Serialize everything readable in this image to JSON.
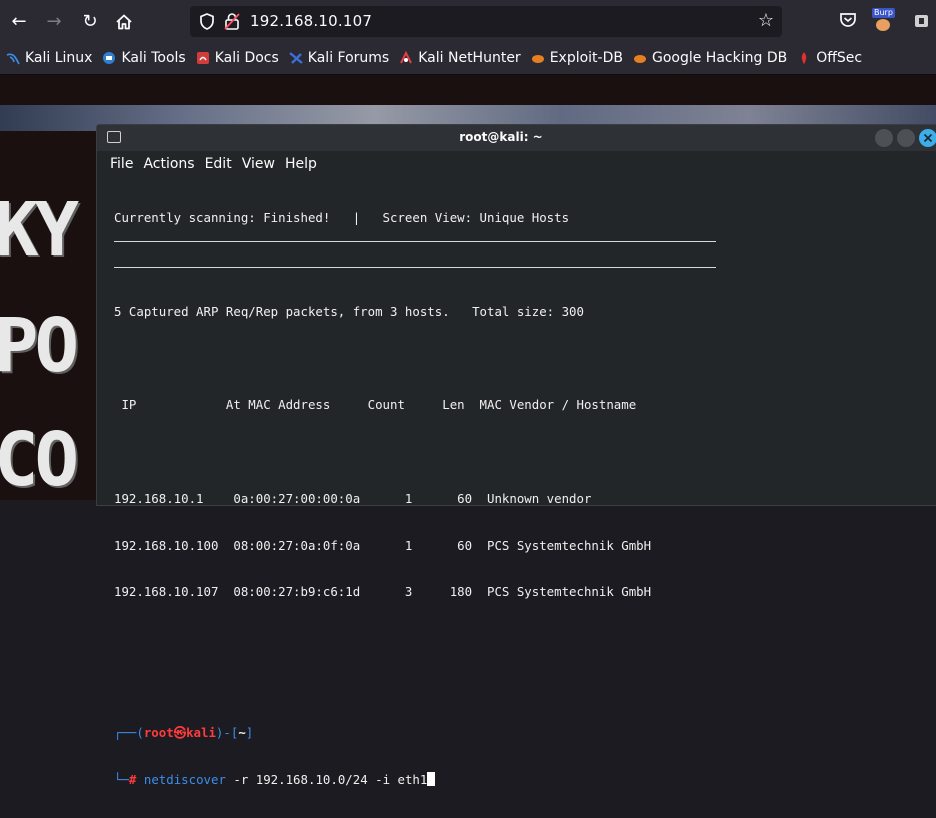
{
  "browser": {
    "url": "192.168.10.107",
    "burp_badge": "Burp"
  },
  "bookmarks": [
    {
      "label": "Kali Linux",
      "icon": "kali-dragon-icon",
      "color": "#3b8eea"
    },
    {
      "label": "Kali Tools",
      "icon": "kali-tools-icon",
      "color": "#2d7fd3"
    },
    {
      "label": "Kali Docs",
      "icon": "kali-docs-icon",
      "color": "#d23c3c"
    },
    {
      "label": "Kali Forums",
      "icon": "kali-forums-icon",
      "color": "#3a6fd8"
    },
    {
      "label": "Kali NetHunter",
      "icon": "nethunter-icon",
      "color": "#e04040"
    },
    {
      "label": "Exploit-DB",
      "icon": "exploit-db-icon",
      "color": "#e67e22"
    },
    {
      "label": "Google Hacking DB",
      "icon": "ghdb-icon",
      "color": "#e67e22"
    },
    {
      "label": "OffSec",
      "icon": "offsec-icon",
      "color": "#e03030"
    }
  ],
  "wallpaper_letters": [
    "KY",
    "PO",
    "CO"
  ],
  "terminal": {
    "title": "root@kali: ~",
    "menu": [
      "File",
      "Actions",
      "Edit",
      "View",
      "Help"
    ],
    "status_line": "Currently scanning: Finished!   |   Screen View: Unique Hosts",
    "summary_line": "5 Captured ARP Req/Rep packets, from 3 hosts.   Total size: 300",
    "header_line": " IP            At MAC Address     Count     Len  MAC Vendor / Hostname",
    "rows": [
      "192.168.10.1    0a:00:27:00:00:0a      1      60  Unknown vendor",
      "192.168.10.100  08:00:27:0a:0f:0a      1      60  PCS Systemtechnik GmbH",
      "192.168.10.107  08:00:27:b9:c6:1d      3     180  PCS Systemtechnik GmbH"
    ],
    "prompt": {
      "open": "┌──(",
      "user": "root",
      "at": "㉿",
      "host": "kali",
      "close": ")-[",
      "dir": "~",
      "end": "]",
      "corner": "└─",
      "hash": "#",
      "command": "netdiscover",
      "args": " -r 192.168.10.0/24 -i eth1"
    }
  }
}
